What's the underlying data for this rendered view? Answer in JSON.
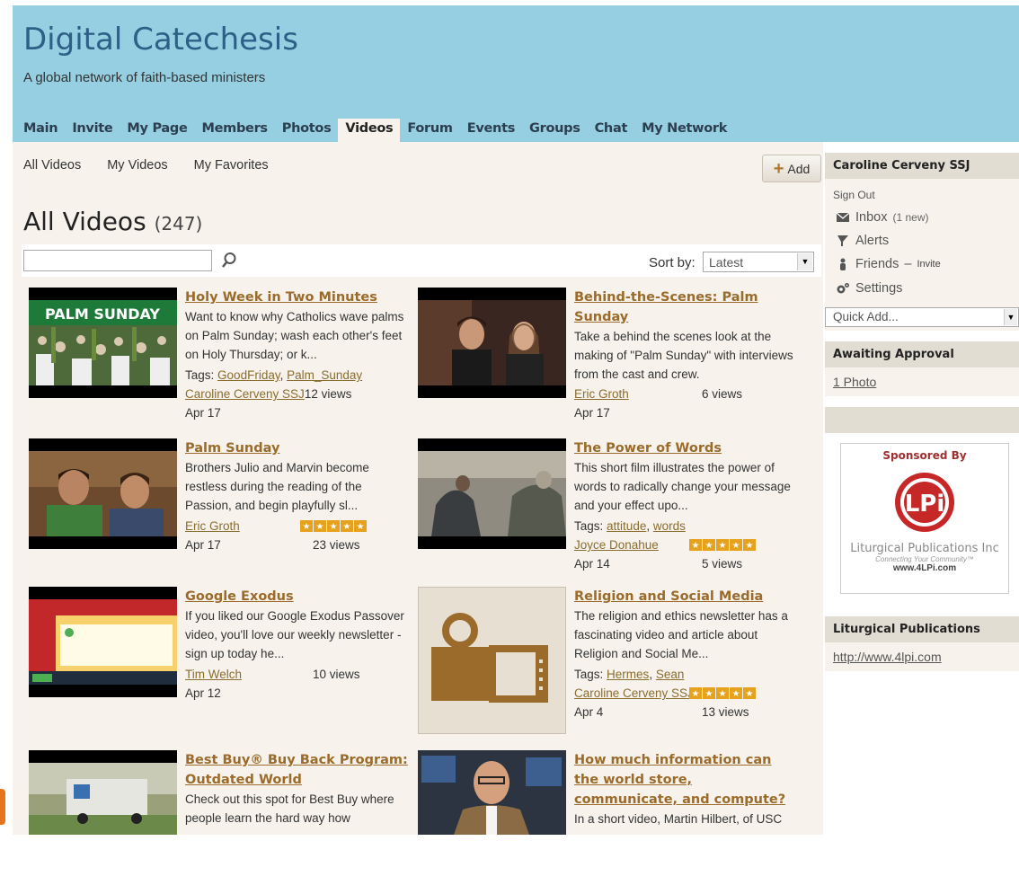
{
  "site": {
    "title": "Digital Catechesis",
    "subtitle": "A global network of faith-based ministers"
  },
  "nav": [
    "Main",
    "Invite",
    "My Page",
    "Members",
    "Photos",
    "Videos",
    "Forum",
    "Events",
    "Groups",
    "Chat",
    "My Network"
  ],
  "nav_active": "Videos",
  "subnav": [
    "All Videos",
    "My Videos",
    "My Favorites"
  ],
  "add_label": "Add",
  "heading": {
    "title": "All Videos",
    "count": "(247)"
  },
  "search": {
    "value": ""
  },
  "sort": {
    "label": "Sort by:",
    "selected": "Latest"
  },
  "videos": [
    {
      "title": "Holy Week in Two Minutes",
      "desc": "Want to know why Catholics wave palms on Palm Sunday; wash each other's feet on Holy Thursday; or k...",
      "tags_label": "Tags:",
      "tags": [
        "GoodFriday",
        "Palm_Sunday"
      ],
      "author": "Caroline Cerveny SSJ",
      "views": "12 views",
      "date": "Apr 17",
      "rating": null,
      "thumb_text": "PALM SUNDAY"
    },
    {
      "title": "Behind-the-Scenes: Palm Sunday",
      "desc": "Take a behind the scenes look at the making of \"Palm Sunday\" with interviews from the cast and crew.",
      "tags_label": "",
      "tags": [],
      "author": "Eric Groth",
      "views": "6 views",
      "date": "Apr 17",
      "rating": null
    },
    {
      "title": "Palm Sunday",
      "desc": "Brothers Julio and Marvin become restless during the reading of the Passion, and begin playfully sl...",
      "tags_label": "",
      "tags": [],
      "author": "Eric Groth",
      "views": "23 views",
      "date": "Apr 17",
      "rating": 5
    },
    {
      "title": "The Power of Words",
      "desc": "This short film illustrates the power of words to radically change your message and your effect upo...",
      "tags_label": "Tags:",
      "tags": [
        "attitude",
        "words"
      ],
      "author": "Joyce Donahue",
      "views": "5 views",
      "date": "Apr 14",
      "rating": 5
    },
    {
      "title": "Google Exodus",
      "desc": "If you liked our Google Exodus Passover video, you'll love our weekly newsletter - sign up today he...",
      "tags_label": "",
      "tags": [],
      "author": "Tim Welch",
      "views": "10 views",
      "date": "Apr 12",
      "rating": null
    },
    {
      "title": "Religion and Social Media",
      "desc": "The religion and ethics newsletter has a fascinating video and article about Religion and Social Me...",
      "tags_label": "Tags:",
      "tags": [
        "Hermes",
        "Sean"
      ],
      "author": "Caroline Cerveny SSJ",
      "views": "13 views",
      "date": "Apr 4",
      "rating": 5
    },
    {
      "title": "Best Buy® Buy Back Program: Outdated World",
      "desc": "Check out this spot for Best Buy where people learn the hard way how",
      "tags_label": "",
      "tags": [],
      "author": "",
      "views": "",
      "date": "",
      "rating": null
    },
    {
      "title": "How much information can the world store, communicate, and compute?",
      "desc": "In a short video, Martin Hilbert, of USC",
      "tags_label": "",
      "tags": [],
      "author": "",
      "views": "",
      "date": "",
      "rating": null
    }
  ],
  "sidebar": {
    "user": "Caroline Cerveny SSJ",
    "signout": "Sign Out",
    "inbox": "Inbox",
    "inbox_new": "(1 new)",
    "alerts": "Alerts",
    "friends": "Friends",
    "friends_sep": "–",
    "friends_invite": "Invite",
    "settings": "Settings",
    "quickadd": "Quick Add...",
    "approval_title": "Awaiting Approval",
    "approval_link": "1 Photo",
    "ad_sponsored": "Sponsored By",
    "ad_logo": "LPi",
    "ad_company": "Liturgical Publications Inc",
    "ad_tagline": "Connecting Your Community™",
    "ad_url": "www.4LPi.com",
    "lp_title": "Liturgical Publications",
    "lp_link": "http://www.4lpi.com"
  },
  "colors": {
    "header": "#95cfe1",
    "panel": "#f7f3ec",
    "link": "#9b6b2b",
    "star": "#e7a21d"
  }
}
